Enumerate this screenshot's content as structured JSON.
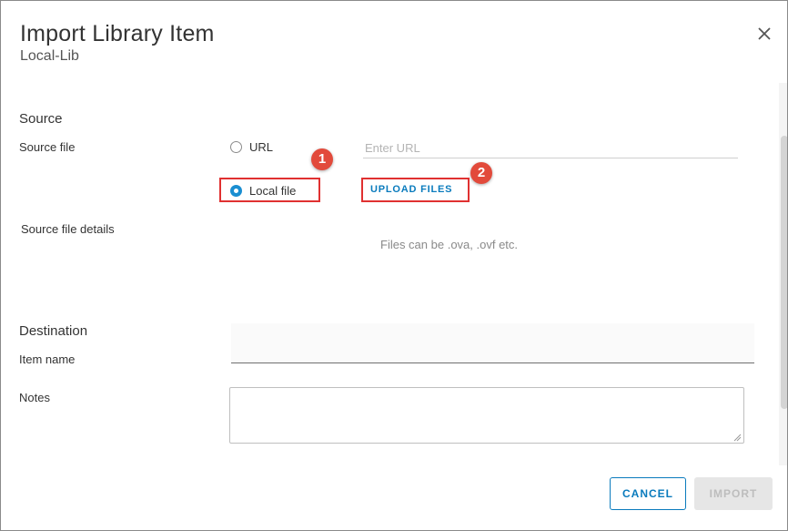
{
  "dialog": {
    "title": "Import Library Item",
    "subtitle": "Local-Lib",
    "close_icon": "close-icon"
  },
  "source": {
    "section_title": "Source",
    "source_file_label": "Source file",
    "url_option_label": "URL",
    "url_placeholder": "Enter URL",
    "local_file_label": "Local file",
    "selected_option": "Local file",
    "upload_button_label": "UPLOAD FILES",
    "details_label": "Source file details",
    "details_hint": "Files can be .ova, .ovf etc."
  },
  "annotations": {
    "badge_1": "1",
    "badge_2": "2",
    "highlight_color": "#e03131",
    "badge_color": "#e24a3b"
  },
  "destination": {
    "section_title": "Destination",
    "item_name_label": "Item name",
    "item_name_value": "",
    "notes_label": "Notes",
    "notes_value": ""
  },
  "footer": {
    "cancel_label": "CANCEL",
    "import_label": "IMPORT"
  },
  "colors": {
    "accent": "#0a7bbd",
    "radio_selected": "#1a8ed1"
  }
}
